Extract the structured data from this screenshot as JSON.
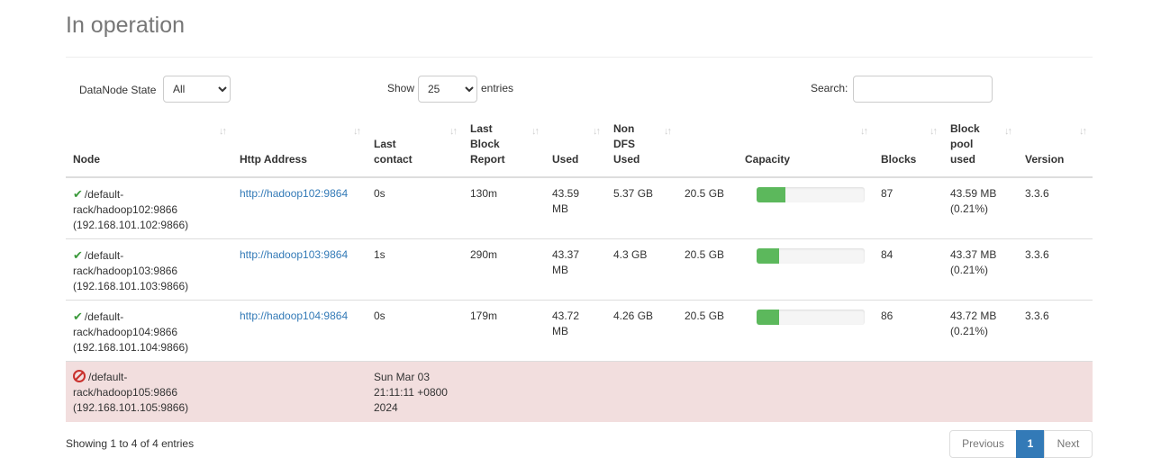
{
  "title": "In operation",
  "controls": {
    "state_label": "DataNode State",
    "state_value": "All",
    "show_label": "Show",
    "show_value": "25",
    "entries_label": "entries",
    "search_label": "Search:",
    "search_value": ""
  },
  "columns": [
    "Node",
    "Http Address",
    "Last contact",
    "Last Block Report",
    "Used",
    "Non DFS Used",
    "Capacity",
    "Blocks",
    "Block pool used",
    "Version"
  ],
  "header_lines": {
    "node": [
      "Node"
    ],
    "http": [
      "Http Address"
    ],
    "contact": [
      "Last",
      "contact"
    ],
    "report": [
      "Last",
      "Block",
      "Report"
    ],
    "used": [
      "Used"
    ],
    "nondfs": [
      "Non",
      "DFS",
      "Used"
    ],
    "capacity": [
      "Capacity"
    ],
    "blocks": [
      "Blocks"
    ],
    "bpused": [
      "Block",
      "pool",
      "used"
    ],
    "version": [
      "Version"
    ]
  },
  "rows": [
    {
      "status": "live",
      "node_lines": [
        "/default-",
        "rack/hadoop102:9866",
        "(192.168.101.102:9866)"
      ],
      "http": "http://hadoop102:9864",
      "last_contact": [
        "0s"
      ],
      "last_block_report": "130m",
      "used": [
        "43.59",
        "MB"
      ],
      "non_dfs_used": "5.37 GB",
      "capacity": "20.5 GB",
      "capacity_used_fraction": 0.27,
      "blocks": "87",
      "block_pool_used": [
        "43.59 MB",
        "(0.21%)"
      ],
      "version": "3.3.6"
    },
    {
      "status": "live",
      "node_lines": [
        "/default-",
        "rack/hadoop103:9866",
        "(192.168.101.103:9866)"
      ],
      "http": "http://hadoop103:9864",
      "last_contact": [
        "1s"
      ],
      "last_block_report": "290m",
      "used": [
        "43.37",
        "MB"
      ],
      "non_dfs_used": "4.3 GB",
      "capacity": "20.5 GB",
      "capacity_used_fraction": 0.21,
      "blocks": "84",
      "block_pool_used": [
        "43.37 MB",
        "(0.21%)"
      ],
      "version": "3.3.6"
    },
    {
      "status": "live",
      "node_lines": [
        "/default-",
        "rack/hadoop104:9866",
        "(192.168.101.104:9866)"
      ],
      "http": "http://hadoop104:9864",
      "last_contact": [
        "0s"
      ],
      "last_block_report": "179m",
      "used": [
        "43.72",
        "MB"
      ],
      "non_dfs_used": "4.26 GB",
      "capacity": "20.5 GB",
      "capacity_used_fraction": 0.21,
      "blocks": "86",
      "block_pool_used": [
        "43.72 MB",
        "(0.21%)"
      ],
      "version": "3.3.6"
    },
    {
      "status": "dead",
      "node_lines": [
        "/default-",
        "rack/hadoop105:9866",
        "(192.168.101.105:9866)"
      ],
      "http": "",
      "last_contact": [
        "Sun Mar 03",
        "21:11:11 +0800",
        "2024"
      ],
      "last_block_report": "",
      "used": [],
      "non_dfs_used": "",
      "capacity": "",
      "capacity_used_fraction": null,
      "blocks": "",
      "block_pool_used": [],
      "version": ""
    }
  ],
  "footer": {
    "info": "Showing 1 to 4 of 4 entries",
    "prev": "Previous",
    "page": "1",
    "next": "Next"
  },
  "colors": {
    "live_icon": "#3c9a3c",
    "dead_icon": "#c9302c",
    "dead_row_bg": "#f2dede",
    "capacity_fill": "#5cb85c",
    "link": "#337ab7",
    "active_page": "#337ab7"
  },
  "icons": {
    "live": "check-icon",
    "dead": "ban-icon",
    "sort": "sort-icon"
  }
}
